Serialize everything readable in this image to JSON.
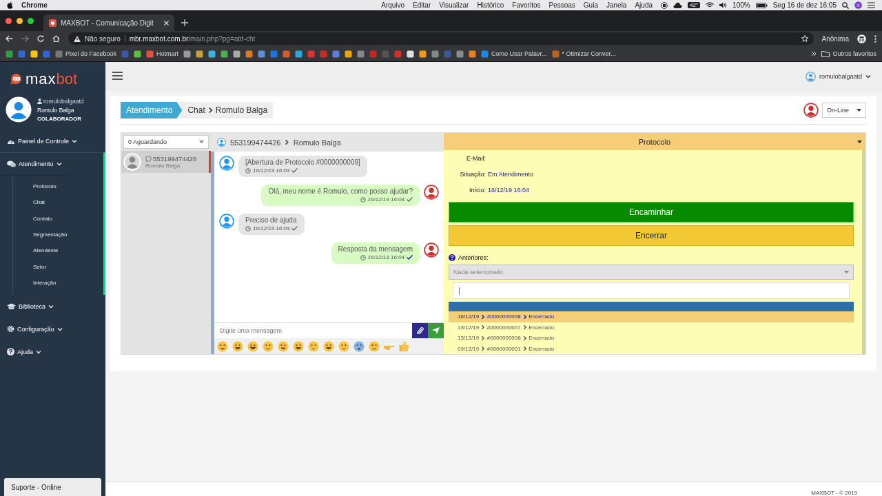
{
  "mac_menu": {
    "app": "Chrome",
    "items": [
      "Arquivo",
      "Editar",
      "Visualizar",
      "Histórico",
      "Favoritos",
      "Pessoas",
      "Guia",
      "Janela",
      "Ajuda"
    ],
    "temperature": "42°",
    "battery": "100%",
    "clock": "Seg 16 de dez  16:05"
  },
  "browser": {
    "tab_title": "MAXBOT - Comunicação Digit",
    "security": "Não seguro",
    "url_host": "mbr.maxbot.com.br",
    "url_path": "/main.php?pg=atd-cht",
    "profile": "Anônima",
    "bookmarks": [
      "Pixel do Facebook",
      "Hotmart",
      "Como Usar Palavr...",
      "* Otimizar Conver..."
    ],
    "other_bookmarks": "Outros favoritos"
  },
  "sidebar": {
    "logo": [
      "max",
      "bot"
    ],
    "username": "romulobalgaatd",
    "name": "Romulo Balga",
    "role": "COLABORADOR",
    "items": [
      {
        "kind": "dashboard",
        "label": "Painel de Controle",
        "expanded": false
      },
      {
        "kind": "chat",
        "label": "Atendimento",
        "expanded": true,
        "children": [
          "Protocolo",
          "Chat",
          "Contato",
          "Segmentação",
          "Atendente",
          "Setor",
          "Interação"
        ]
      },
      {
        "kind": "library",
        "label": "Biblioteca",
        "expanded": false
      },
      {
        "kind": "settings",
        "label": "Configuração",
        "expanded": false
      },
      {
        "kind": "help",
        "label": "Ajuda",
        "expanded": false
      }
    ],
    "support": "Suporte - Online"
  },
  "header": {
    "user": "romulobalgaatd"
  },
  "breadcrumb": {
    "section": "Atendimento",
    "page": "Chat",
    "contact": "Romulo Balga"
  },
  "status_select": {
    "value": "On-Line"
  },
  "queue_select": {
    "value": "0 Aguardando"
  },
  "contacts": [
    {
      "phone": "553199474426",
      "name": "Romulo Balga",
      "selected": true
    }
  ],
  "chat": {
    "phone": "553199474426",
    "name": "Romulo Balga",
    "messages": [
      {
        "kind": "received",
        "text": "[Abertura de Protocolo #0000000009]",
        "time": "16/12/19 16:03",
        "read": false
      },
      {
        "kind": "sent",
        "text": "Olá, meu nome é Romulo, como posso ajudar?",
        "time": "16/12/19 16:04",
        "read": false
      },
      {
        "kind": "received",
        "text": "Preciso de ajuda",
        "time": "16/12/19 16:04",
        "read": false
      },
      {
        "kind": "sent",
        "text": "Resposta da mensagem",
        "time": "16/12/19 16:04",
        "read": true
      }
    ],
    "input": {
      "placeholder": "Digite uma mensagem"
    }
  },
  "protocol": {
    "title": "Protocolo",
    "fields": [
      {
        "label": "E-Mail:"
      },
      {
        "label": "Situação:",
        "value": "Em Atendimento"
      },
      {
        "label": "Início:",
        "value": "16/12/19 16:04"
      }
    ],
    "forward_button": "Encaminhar",
    "close_button": "Encerrar",
    "previous_label": "Anteriores:",
    "previous_select": {
      "placeholder": "Nada selecionado"
    },
    "previous": [
      {
        "date": "16/12/19",
        "number": "#0000000008",
        "status": "Encerrado",
        "selected": true
      },
      {
        "date": "13/12/19",
        "number": "#0000000007",
        "status": "Encerrado",
        "selected": false
      },
      {
        "date": "13/12/19",
        "number": "#0000000006",
        "status": "Encerrado",
        "selected": false
      },
      {
        "date": "09/12/19",
        "number": "#0000000001",
        "status": "Encerrado",
        "selected": false
      }
    ]
  },
  "footer": "MAXBOT - © 2019"
}
